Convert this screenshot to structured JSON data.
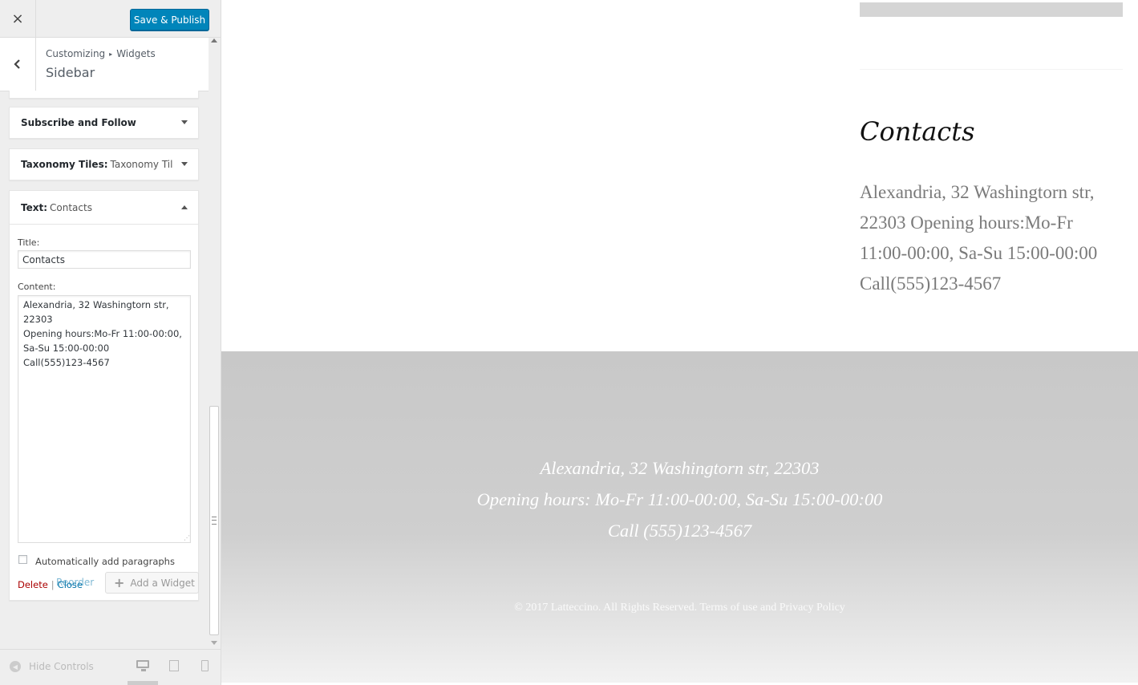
{
  "topbar": {
    "close_icon": "×",
    "publish_label": "Save & Publish"
  },
  "section": {
    "breadcrumb_root": "Customizing",
    "breadcrumb_sep": "▸",
    "breadcrumb_parent": "Widgets",
    "title": "Sidebar"
  },
  "widgets": [
    {
      "type": "Subscribe and Follow",
      "title": ""
    },
    {
      "type": "Taxonomy Tiles:",
      "title": "Taxonomy Til..."
    },
    {
      "type": "Text:",
      "title": "Contacts"
    }
  ],
  "text_widget": {
    "title_label": "Title:",
    "title_value": "Contacts",
    "content_label": "Content:",
    "content_value": "Alexandria, 32 Washingtorn str, 22303\nOpening hours:Mo-Fr 11:00-00:00, Sa-Su 15:00-00:00\nCall(555)123-4567",
    "autop_label": "Automatically add paragraphs",
    "autop_checked": false,
    "delete_label": "Delete",
    "close_label": "Close"
  },
  "area_actions": {
    "reorder_label": "Reorder",
    "add_widget_label": "Add a Widget"
  },
  "footer_controls": {
    "hide_controls_label": "Hide Controls",
    "active_device": "desktop"
  },
  "preview": {
    "contacts_title": "Contacts",
    "contacts_body": "Alexandria, 32 Washingtorn str, 22303 Opening hours:Mo-Fr 11:00-00:00, Sa-Su 15:00-00:00 Call(555)123-4567",
    "footer_line1": "Alexandria, 32 Washingtorn str, 22303",
    "footer_line2": "Opening hours: Mo-Fr 11:00-00:00, Sa-Su 15:00-00:00",
    "footer_line3": "Call (555)123-4567",
    "copyright": "© 2017 Latteccino. All Rights Reserved. Terms of use and Privacy Policy"
  },
  "colors": {
    "accent": "#0085ba",
    "link": "#0073aa",
    "delete": "#aa0000",
    "panel_bg": "#eeeeee"
  }
}
